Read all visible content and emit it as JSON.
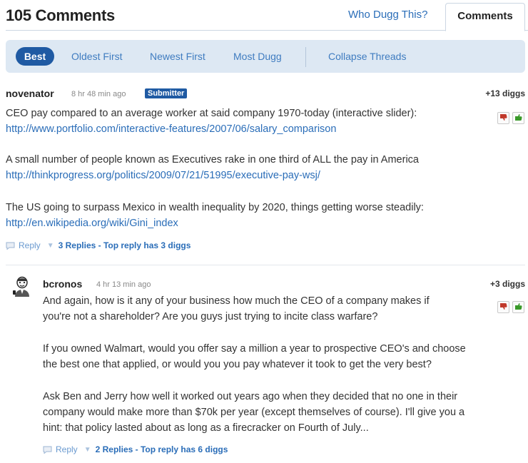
{
  "header": {
    "title": "105 Comments",
    "tabs": {
      "who_dugg": "Who Dugg This?",
      "comments": "Comments"
    }
  },
  "sort": {
    "items": [
      "Best",
      "Oldest First",
      "Newest First",
      "Most Dugg"
    ],
    "collapse": "Collapse Threads"
  },
  "comments": [
    {
      "user": "novenator",
      "time": "8 hr 48 min ago",
      "badge": "Submitter",
      "diggs": "+13 diggs",
      "paragraphs": [
        {
          "text": "CEO pay compared to an average worker at said company 1970-today (interactive slider):",
          "link": "http://www.portfolio.com/interactive-features/2007/06/salary_comparison"
        },
        {
          "text": "A small number of people known as Executives rake in one third of ALL the pay in America",
          "link": "http://thinkprogress.org/politics/2009/07/21/51995/executive-pay-wsj/"
        },
        {
          "text": "The US going to surpass Mexico in wealth inequality by 2020, things getting worse steadily:",
          "link": "http://en.wikipedia.org/wiki/Gini_index"
        }
      ],
      "reply_label": "Reply",
      "replies_summary": "3 Replies - Top reply has 3 diggs"
    },
    {
      "user": "bcronos",
      "time": "4 hr 13 min ago",
      "diggs": "+3 diggs",
      "lines": [
        "And again, how is it any of your business how much the CEO of a company makes if",
        "you're not a shareholder? Are you guys just trying to incite class warfare?",
        "If you owned Walmart, would you offer say a million a year to prospective CEO's and choose",
        "the best one that applied, or would you you pay whatever it took to get the very best?",
        "Ask Ben and Jerry how well it worked out years ago when they decided that no one in their",
        "company would make more than $70k per year (except themselves of course). I'll give you a",
        "hint: that policy lasted about as long as a firecracker on Fourth of July..."
      ],
      "reply_label": "Reply",
      "replies_summary": "2 Replies - Top reply has 6 diggs"
    }
  ],
  "icons": {
    "bury": "thumbs-down-icon",
    "digg": "thumbs-up-icon",
    "reply": "speech-bubble-icon",
    "avatar": "avatar"
  },
  "colors": {
    "accent": "#1f5aa3",
    "link": "#2a6db8",
    "sortbar_bg": "#dde8f3",
    "bury": "#c0392b",
    "digg": "#3a9a2a"
  }
}
